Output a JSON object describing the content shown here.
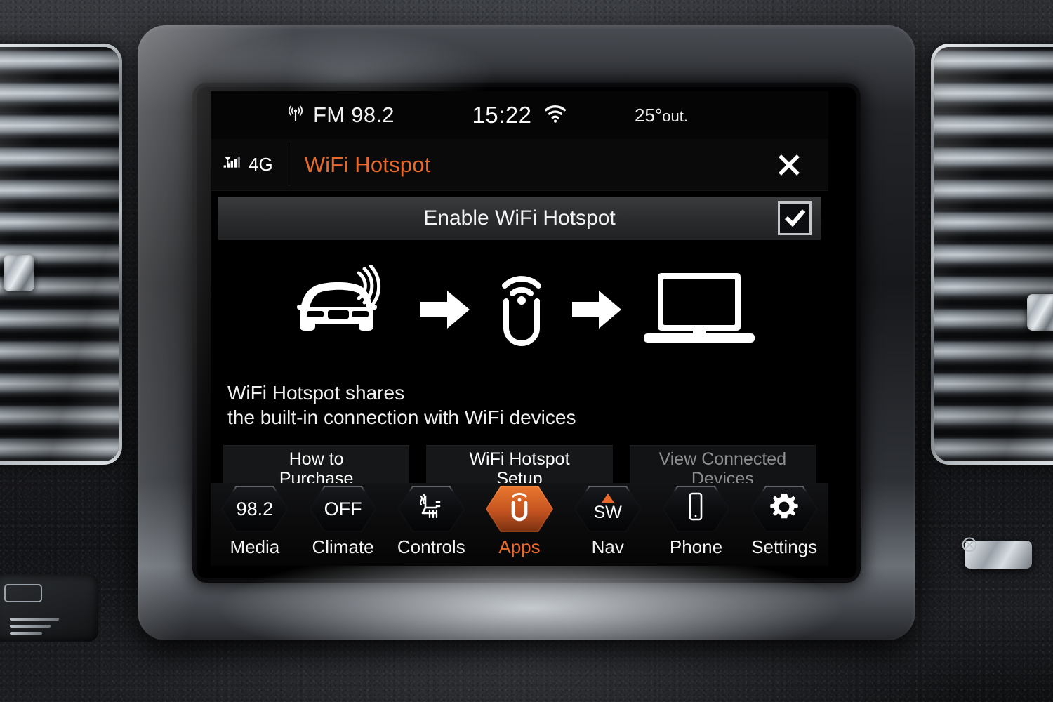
{
  "status_bar": {
    "radio_icon": "broadcast-antenna-icon",
    "radio_source": "FM 98.2",
    "time": "15:22",
    "wifi_icon": "wifi-icon",
    "temperature": "25°",
    "temperature_suffix": "out."
  },
  "title_bar": {
    "signal_icon": "cellular-signal-icon",
    "network": "4G",
    "title": "WiFi Hotspot",
    "close_icon": "close-icon",
    "title_color": "#e8692a"
  },
  "enable_row": {
    "label": "Enable WiFi Hotspot",
    "checked": true,
    "checkbox_icon": "checkmark-icon"
  },
  "illustration": {
    "car_icon": "car-broadcasting-icon",
    "arrow1_icon": "arrow-right-icon",
    "hotspot_icon": "uconnect-wifi-icon",
    "arrow2_icon": "arrow-right-icon",
    "laptop_icon": "laptop-icon"
  },
  "description": {
    "line1": "WiFi Hotspot shares",
    "line2": "the built-in connection with WiFi devices"
  },
  "actions": [
    {
      "line1": "How to",
      "line2": "Purchase",
      "disabled": false
    },
    {
      "line1": "WiFi Hotspot",
      "line2": "Setup",
      "disabled": false
    },
    {
      "line1": "View Connected",
      "line2": "Devices",
      "disabled": true
    }
  ],
  "nav": [
    {
      "label": "Media",
      "value": "98.2",
      "icon": "",
      "active": false
    },
    {
      "label": "Climate",
      "value": "OFF",
      "icon": "",
      "active": false
    },
    {
      "label": "Controls",
      "value": "",
      "icon": "heated-seat-icon",
      "active": false
    },
    {
      "label": "Apps",
      "value": "",
      "icon": "uconnect-logo-icon",
      "active": true
    },
    {
      "label": "Nav",
      "value": "SW",
      "icon": "compass-heading-icon",
      "active": false
    },
    {
      "label": "Phone",
      "value": "",
      "icon": "smartphone-icon",
      "active": false
    },
    {
      "label": "Settings",
      "value": "",
      "icon": "gear-icon",
      "active": false
    }
  ],
  "theme": {
    "accent": "#e8692a",
    "screen_bg": "#000000",
    "text": "#f2f2f2",
    "disabled_text": "#8d8f92"
  }
}
